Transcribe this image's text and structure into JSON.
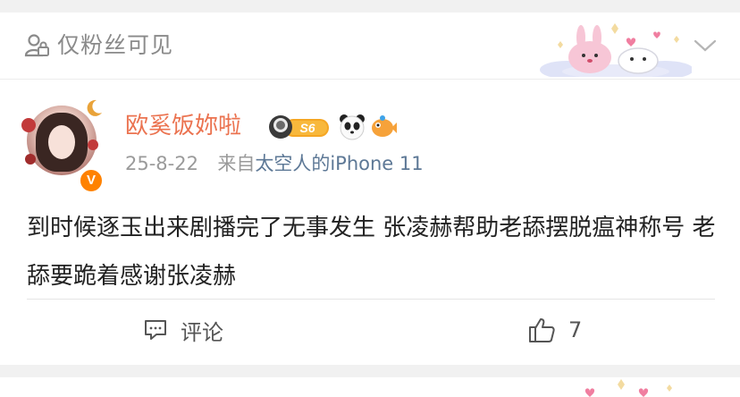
{
  "privacy": {
    "label": "仅粉丝可见",
    "icon": "lock-person-icon"
  },
  "header_decoration": "kanahei-bunny-seal-sticker",
  "expand_icon": "chevron-down-icon",
  "author": {
    "name": "欧奚饭妳啦",
    "verified_icon": "orange-v-badge",
    "verified_text": "V",
    "level_badge": "S6",
    "emoji_badges": [
      "astronaut-icon",
      "panda-icon",
      "pufferfish-icon"
    ],
    "accent_color": "#eb7350"
  },
  "meta": {
    "date": "25-8-22",
    "source_prefix": "来自",
    "source": "太空人的iPhone 11"
  },
  "post": {
    "text": "到时候逐玉出来剧播完了无事发生 张凌赫帮助老舔摆脱瘟神称号 老舔要跪着感谢张凌赫"
  },
  "actions": {
    "comment_label": "评论",
    "like_count": "7"
  },
  "colors": {
    "link": "#5d7896",
    "muted": "#9a9a9a",
    "background": "#f1f1f1"
  }
}
